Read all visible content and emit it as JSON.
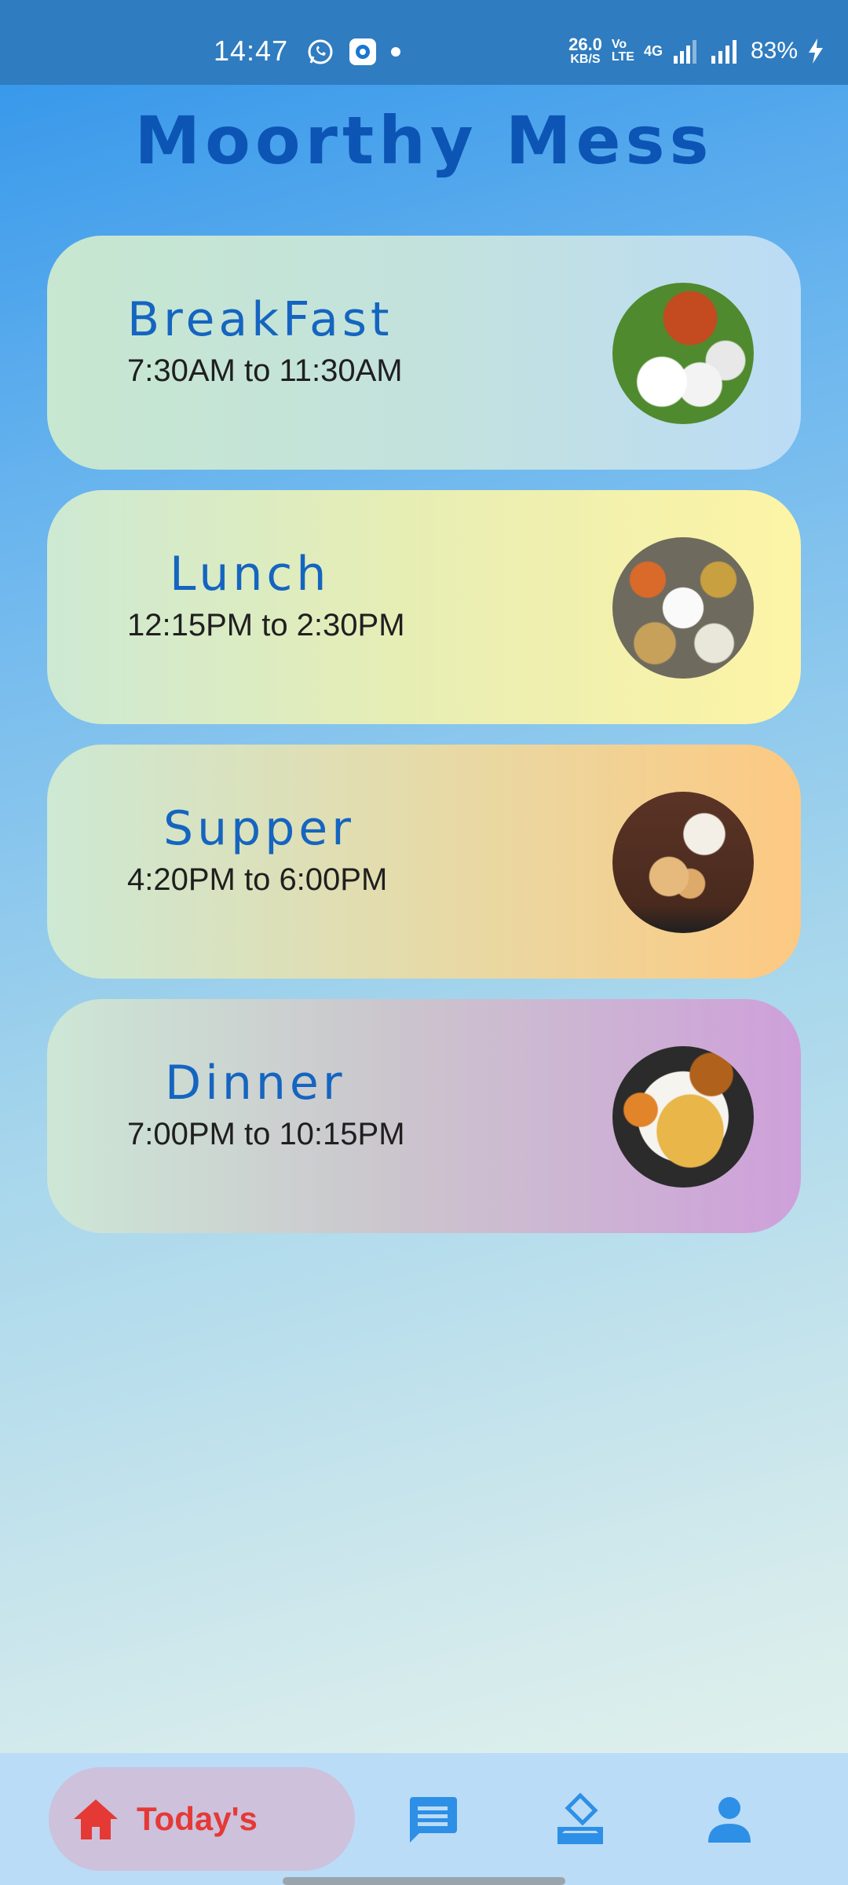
{
  "status_bar": {
    "time": "14:47",
    "net_speed_value": "26.0",
    "net_speed_unit": "KB/S",
    "volte_top": "Vo",
    "volte_bottom": "LTE",
    "network": "4G",
    "battery": "83%",
    "icons": [
      "whatsapp-icon",
      "app-notification-icon",
      "notification-dot",
      "signal-icon",
      "battery-charging-icon"
    ]
  },
  "app": {
    "title": "Moorthy Mess"
  },
  "meals": [
    {
      "name": "BreakFast",
      "time": "7:30AM to 11:30AM",
      "photo": "idli-sambar-photo"
    },
    {
      "name": "Lunch",
      "time": "12:15PM to 2:30PM",
      "photo": "meals-thali-photo"
    },
    {
      "name": "Supper",
      "time": "4:20PM to 6:00PM",
      "photo": "tea-snacks-photo"
    },
    {
      "name": "Dinner",
      "time": "7:00PM to 10:15PM",
      "photo": "dosa-photo"
    }
  ],
  "bottom_nav": {
    "active_label": "Today's",
    "items": [
      "home-icon",
      "chat-icon",
      "vote-icon",
      "profile-icon"
    ],
    "active_color": "#e53935",
    "icon_color": "#2e8fe6"
  }
}
